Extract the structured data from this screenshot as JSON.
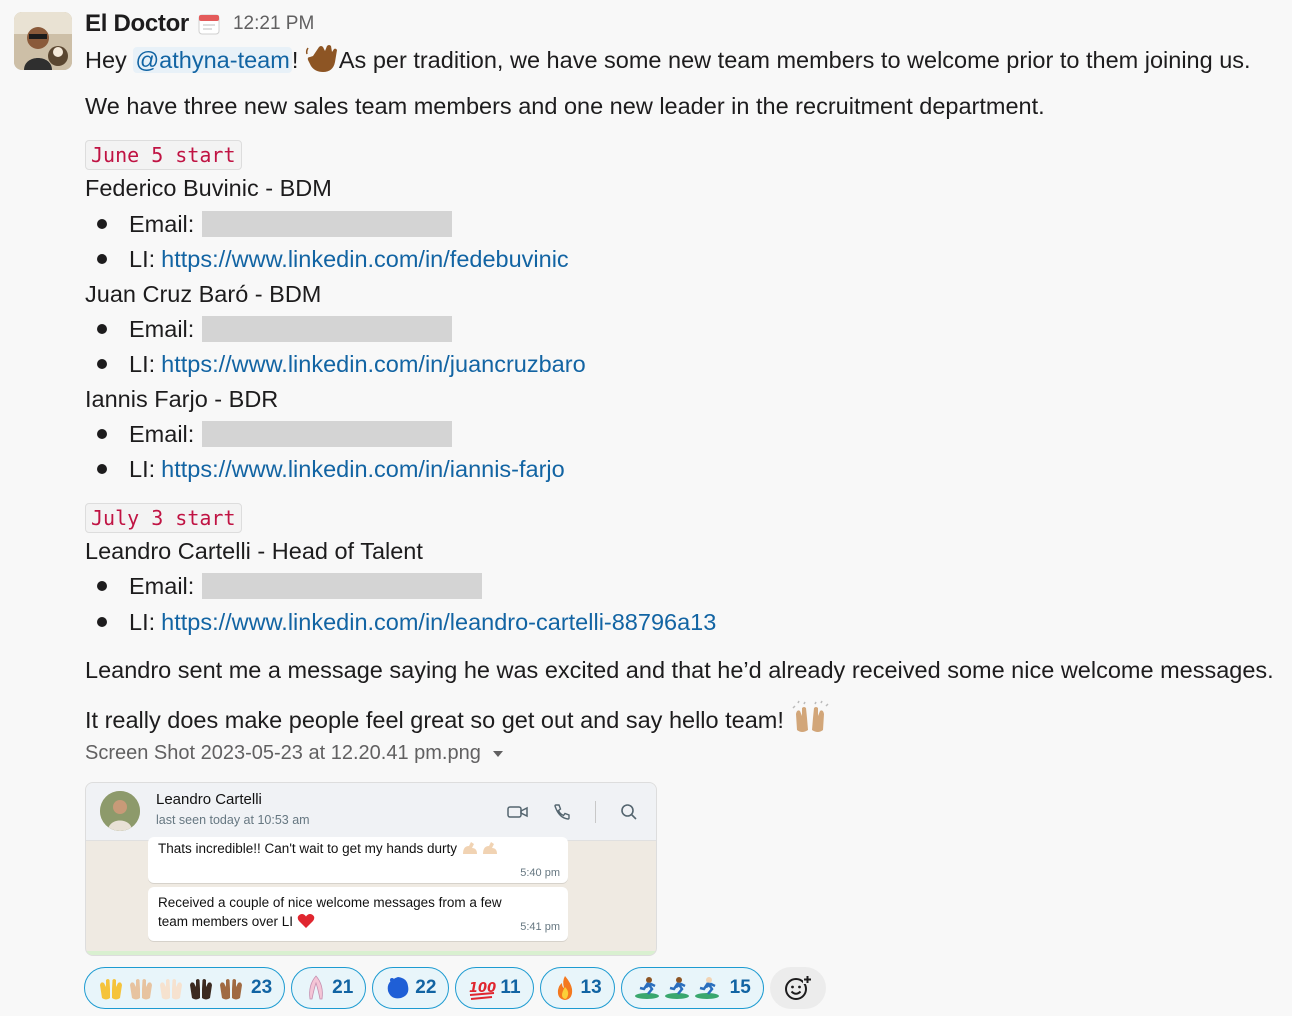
{
  "message": {
    "author": "El Doctor",
    "timestamp": "12:21 PM",
    "greeting_prefix": "Hey ",
    "mention": "@athyna-team",
    "greeting_exclaim": "!",
    "greeting_rest": "As per tradition, we have some new team members to welcome prior to them joining us.",
    "intro": "We have three new sales team members and one new leader in the recruitment department.",
    "groups": [
      {
        "start_tag": "June 5 start",
        "people": [
          {
            "name": "Federico Buvinic - BDM",
            "email_label": "Email:",
            "li_label": "LI:",
            "li_url": "https://www.linkedin.com/in/fedebuvinic"
          },
          {
            "name": "Juan Cruz Baró - BDM",
            "email_label": "Email:",
            "li_label": "LI:",
            "li_url": "https://www.linkedin.com/in/juancruzbaro"
          },
          {
            "name": "Iannis Farjo - BDR",
            "email_label": "Email:",
            "li_label": "LI:",
            "li_url": "https://www.linkedin.com/in/iannis-farjo"
          }
        ]
      },
      {
        "start_tag": "July 3 start",
        "people": [
          {
            "name": "Leandro Cartelli - Head of Talent",
            "email_label": "Email:",
            "li_label": "LI:",
            "li_url": "https://www.linkedin.com/in/leandro-cartelli-88796a13"
          }
        ]
      }
    ],
    "closing_1": "Leandro sent me a message saying he was excited and that he’d already received some nice welcome messages.",
    "closing_2": "It really does make people feel great so get out and say hello team!"
  },
  "attachment": {
    "file_name": "Screen Shot 2023-05-23 at 12.20.41 pm.png",
    "contact_name": "Leandro Cartelli",
    "last_seen": "last seen today at 10:53 am",
    "bubbles": [
      {
        "text": "Thats incredible!! Can't wait to get my hands durty",
        "time": "5:40 pm"
      },
      {
        "text_1": "Received a couple of nice welcome messages from a few",
        "text_2": "team members over LI",
        "time": "5:41 pm"
      }
    ]
  },
  "reactions": [
    {
      "icon": "raised-hands-icon",
      "count": "23"
    },
    {
      "icon": "feather-icon",
      "count": "21"
    },
    {
      "icon": "blue-blob-icon",
      "count": "22"
    },
    {
      "icon": "hundred-points-icon",
      "count": "11"
    },
    {
      "icon": "fire-icon",
      "count": "13"
    },
    {
      "icon": "surfer-icon",
      "count": "15"
    }
  ],
  "colors": {
    "link": "#1264a3",
    "code_text": "#c01343",
    "reaction_border": "#1d9bd1"
  }
}
